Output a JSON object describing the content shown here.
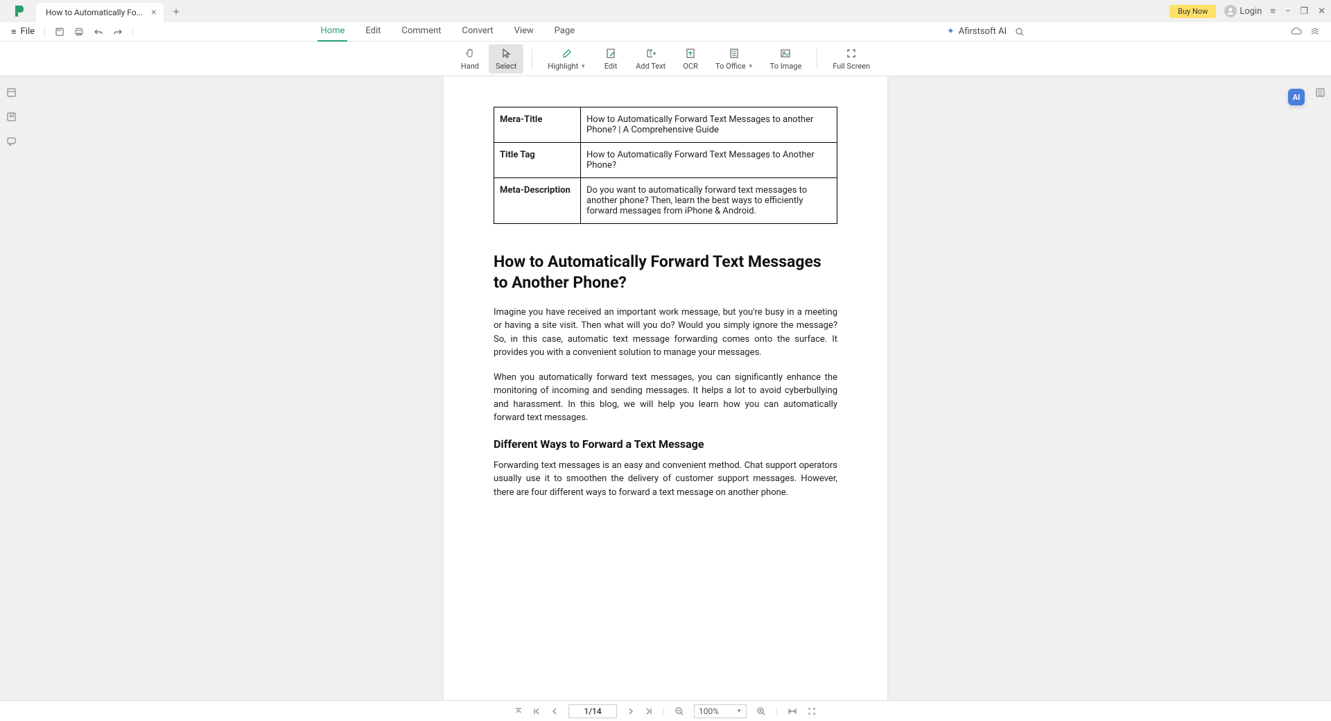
{
  "tab": {
    "title": "How to Automatically Fo..."
  },
  "header": {
    "buy_now": "Buy Now",
    "login": "Login"
  },
  "file_menu": {
    "label": "File"
  },
  "main_tabs": {
    "home": "Home",
    "edit": "Edit",
    "comment": "Comment",
    "convert": "Convert",
    "view": "View",
    "page": "Page"
  },
  "ai": {
    "label": "Afirstsoft AI"
  },
  "tools": {
    "hand": "Hand",
    "select": "Select",
    "highlight": "Highlight",
    "edit": "Edit",
    "add_text": "Add Text",
    "ocr": "OCR",
    "to_office": "To Office",
    "to_image": "To Image",
    "full_screen": "Full Screen"
  },
  "document": {
    "table": {
      "r1_label": "Mera-Title",
      "r1_value": "How to Automatically Forward Text Messages to another Phone? | A Comprehensive Guide",
      "r2_label": "Title Tag",
      "r2_value": "How to Automatically Forward Text Messages to Another Phone?",
      "r3_label": "Meta-Description",
      "r3_value": "Do you want to automatically forward text messages to another phone? Then, learn the best ways to efficiently forward messages from iPhone & Android."
    },
    "h1": "How to Automatically Forward Text Messages to Another Phone?",
    "p1": "Imagine you have received an important work message, but you're busy in a meeting or having a site visit. Then what will you do? Would you simply ignore the message? So, in this case, automatic text message forwarding comes onto the surface. It provides you with a convenient solution to manage your messages.",
    "p2": "When you automatically forward text messages, you can significantly enhance the monitoring of incoming and sending messages. It helps a lot to avoid cyberbullying and harassment. In this blog, we will help you learn how you can automatically forward text messages.",
    "h2": "Different Ways to Forward a Text Message",
    "p3": "Forwarding text messages is an easy and convenient method. Chat support operators usually use it to smoothen the delivery of customer support messages. However, there are four different ways to forward a text message on another phone."
  },
  "status": {
    "page": "1/14",
    "zoom": "100%"
  },
  "ai_badge": "AI"
}
